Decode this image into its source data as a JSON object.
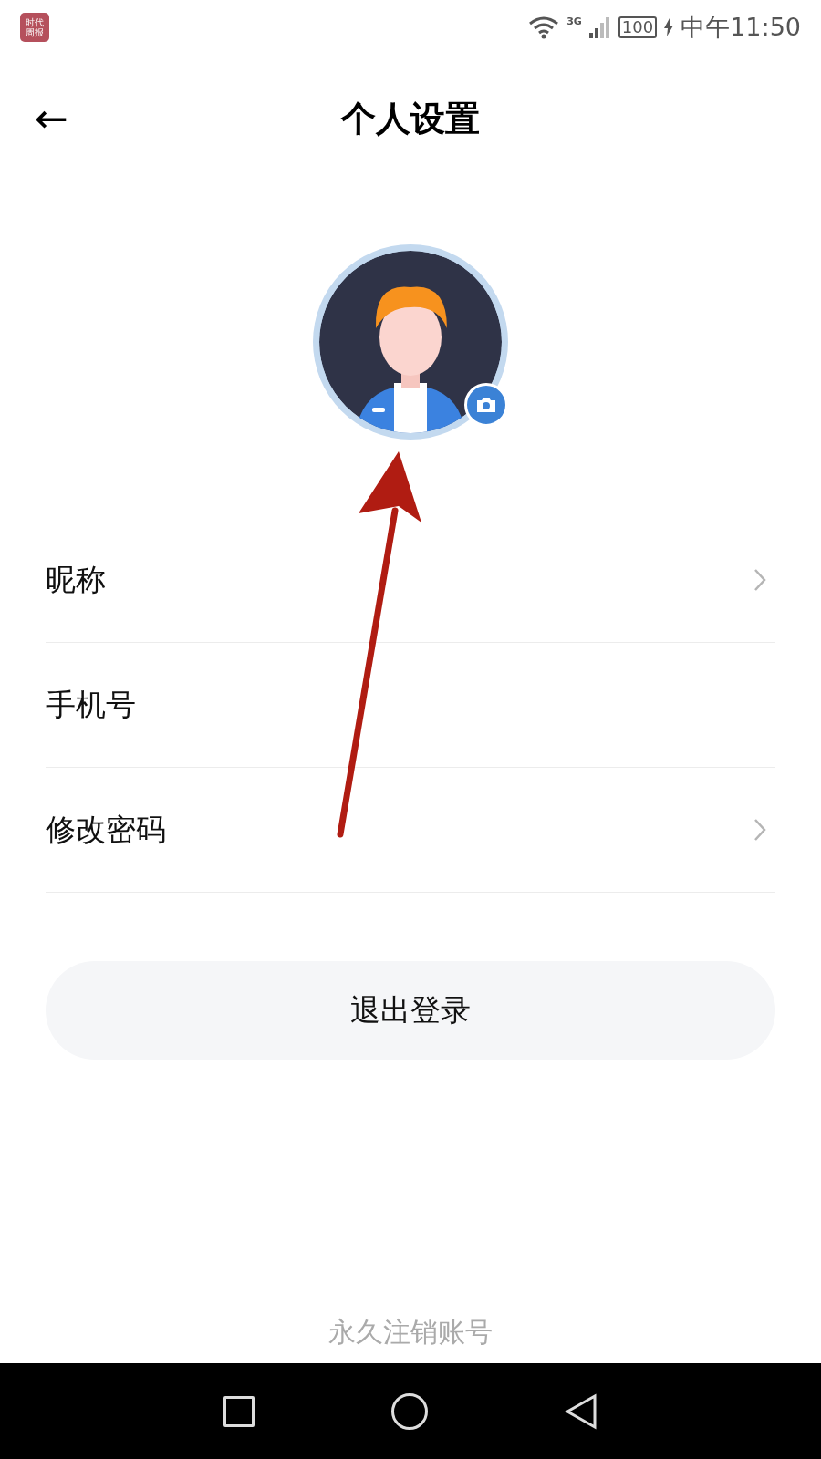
{
  "status_bar": {
    "app_icon_text": "时代周报",
    "network": "3G",
    "battery": "100",
    "time": "中午11:50"
  },
  "header": {
    "back": "←",
    "title": "个人设置"
  },
  "avatar": {
    "camera_badge": true
  },
  "rows": [
    {
      "label": "昵称",
      "chevron": true
    },
    {
      "label": "手机号",
      "chevron": false
    },
    {
      "label": "修改密码",
      "chevron": true
    }
  ],
  "logout_button": "退出登录",
  "deregister_link": "永久注销账号",
  "annotation": {
    "kind": "arrow"
  }
}
